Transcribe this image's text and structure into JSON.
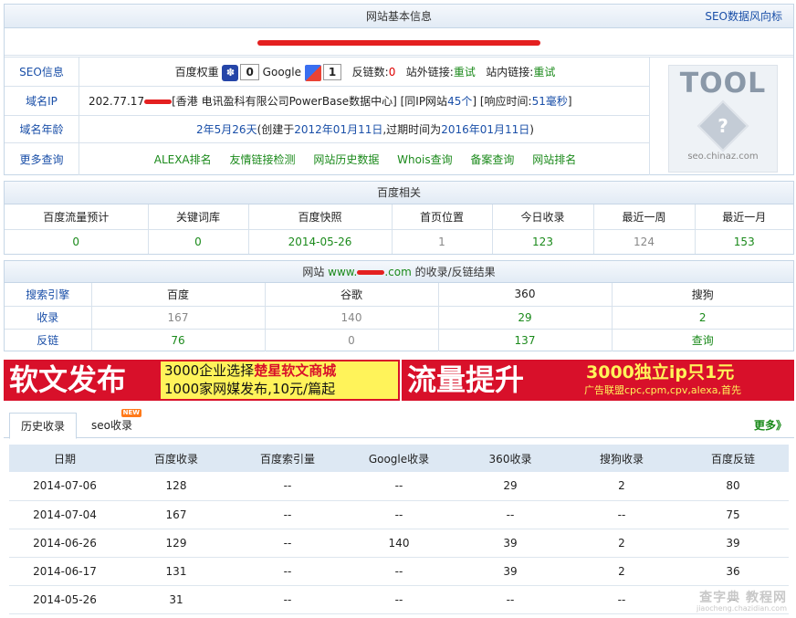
{
  "basic": {
    "title": "网站基本信息",
    "seo_link": "SEO数据风向标",
    "site_name_redacted": "",
    "seo_label": "SEO信息",
    "baidu_weight_label": "百度权重",
    "baidu_weight_value": "0",
    "google_label": "Google",
    "google_pr": "1",
    "backlinks_label": "反链数:",
    "backlinks_value": "0",
    "outlinks_label": "站外链接:",
    "outlinks_value": "重试",
    "inlinks_label": "站内链接:",
    "inlinks_value": "重试",
    "domain_ip_label": "域名IP",
    "ip_prefix": "202.77.17",
    "ip_location": "[香港 电讯盈科有限公司PowerBase数据中心]",
    "same_ip_pre": "[同IP网站",
    "same_ip_count": "45个",
    "same_ip_post": "]",
    "response_pre": "[响应时间:",
    "response_value": "51毫秒",
    "response_post": "]",
    "age_label": "域名年龄",
    "age_value": "2年5月26天",
    "age_detail_1": "(创建于",
    "created": "2012年01月11日",
    "age_detail_2": ",过期时间为",
    "expires": "2016年01月11日",
    "age_detail_3": ")",
    "more_label": "更多查询",
    "more_links": [
      "ALEXA排名",
      "友情链接检测",
      "网站历史数据",
      "Whois查询",
      "备案查询",
      "网站排名"
    ],
    "logo_text": "TOOL",
    "logo_caption": "seo.chinaz.com",
    "logo_q": "?"
  },
  "baidu": {
    "title": "百度相关",
    "headers": [
      "百度流量预计",
      "关键词库",
      "百度快照",
      "首页位置",
      "今日收录",
      "最近一周",
      "最近一月"
    ],
    "values": [
      "0",
      "0",
      "2014-05-26",
      "1",
      "123",
      "124",
      "153"
    ]
  },
  "index": {
    "title_pre": "网站",
    "domain_pre": "www.",
    "domain_post": ".com",
    "title_post": "的收录/反链结果",
    "headers": [
      "搜索引擎",
      "百度",
      "谷歌",
      "360",
      "搜狗"
    ],
    "rows": [
      [
        "收录",
        "167",
        "140",
        "29",
        "2"
      ],
      [
        "反链",
        "76",
        "0",
        "137",
        "查询"
      ]
    ]
  },
  "banner": {
    "left_big": "软文发布",
    "left_line1_a": "3000企业选择",
    "left_line1_b": "楚星软文商城",
    "left_line2": "1000家网媒发布,10元/篇起",
    "right_big": "流量提升",
    "right_line1": "3000独立ip只1元",
    "right_line2": "广告联盟cpc,cpm,cpv,alexa,首先"
  },
  "history": {
    "tabs": [
      "历史收录",
      "seo收录"
    ],
    "new_badge": "NEW",
    "more": "更多》",
    "headers": [
      "日期",
      "百度收录",
      "百度索引量",
      "Google收录",
      "360收录",
      "搜狗收录",
      "百度反链"
    ],
    "rows": [
      [
        "2014-07-06",
        "128",
        "--",
        "--",
        "29",
        "2",
        "80"
      ],
      [
        "2014-07-04",
        "167",
        "--",
        "--",
        "--",
        "--",
        "75"
      ],
      [
        "2014-06-26",
        "129",
        "--",
        "140",
        "39",
        "2",
        "39"
      ],
      [
        "2014-06-17",
        "131",
        "--",
        "--",
        "39",
        "2",
        "36"
      ],
      [
        "2014-05-26",
        "31",
        "--",
        "--",
        "--",
        "--",
        "--"
      ]
    ]
  },
  "watermark": "查字典 教程网",
  "watermark_sub": "jiaocheng.chazidian.com"
}
